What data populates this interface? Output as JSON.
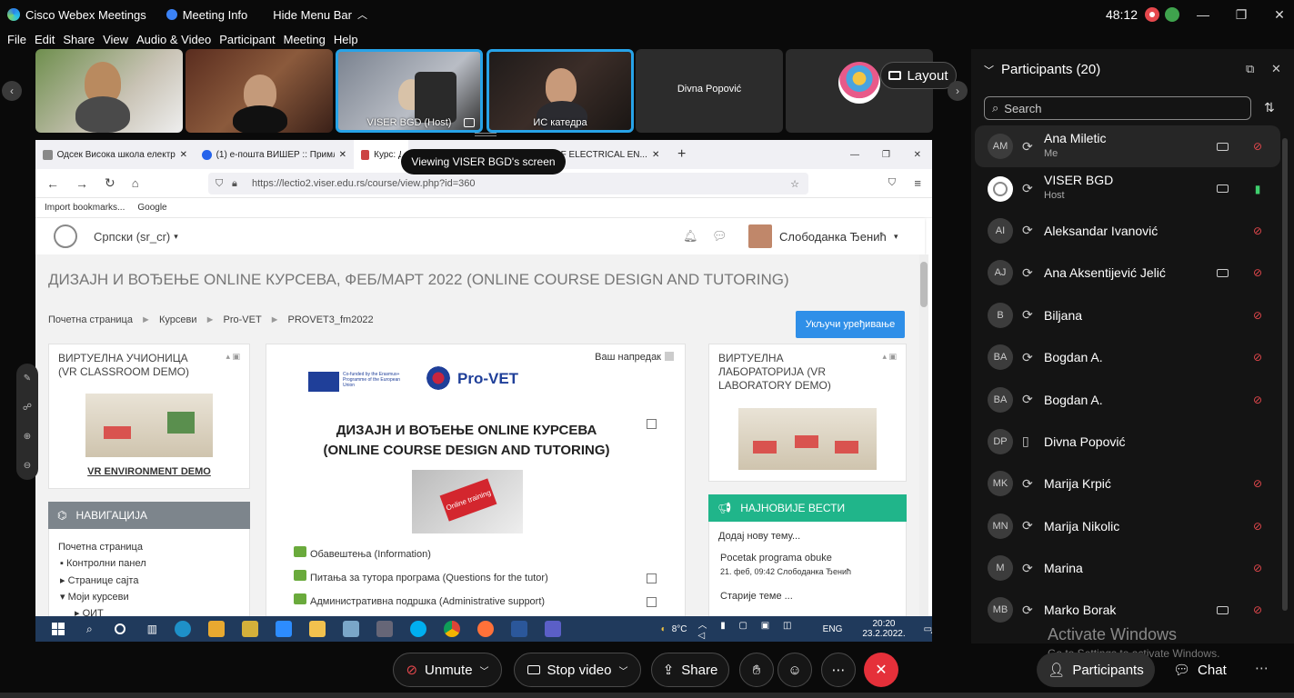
{
  "titlebar": {
    "app": "Cisco Webex Meetings",
    "meeting_info": "Meeting Info",
    "hide_menu": "Hide Menu Bar",
    "timer": "48:12"
  },
  "menu": [
    "File",
    "Edit",
    "Share",
    "View",
    "Audio & Video",
    "Participant",
    "Meeting",
    "Help"
  ],
  "videos": [
    {
      "name": ""
    },
    {
      "name": ""
    },
    {
      "name": "VISER BGD (Host)"
    },
    {
      "name": "ИС катедра"
    },
    {
      "name": "Divna Popović"
    }
  ],
  "layout_label": "Layout",
  "viewing_label": "Viewing VISER BGD's screen",
  "browser": {
    "tabs": [
      "Одсек Висока школа електро...",
      "(1) е-пошта ВИШЕР :: Примље...",
      "Курс: Ди...",
      "...OOL OF ELECTRICAL EN..."
    ],
    "url": "https://lectio2.viser.edu.rs/course/view.php?id=360",
    "bookmarks": [
      "Import bookmarks...",
      "Google"
    ]
  },
  "moodle": {
    "lang": "Српски (sr_cr)",
    "user": "Слободанка Ђенић",
    "course_title": "ДИЗАЈН И ВОЂЕЊЕ ONLINE КУРСЕВА, ФЕБ/МАРТ 2022 (ONLINE COURSE DESIGN AND TUTORING)",
    "breadcrumb": [
      "Почетна страница",
      "Курсеви",
      "Pro-VET",
      "PROVET3_fm2022"
    ],
    "edit_button": "Укључи уређивање",
    "vr_classroom_title": "ВИРТУЕЛНА УЧИОНИЦА (VR CLASSROOM DEMO)",
    "vr_link": "VR ENVIRONMENT DEMO",
    "vr_lab_title": "ВИРТУЕЛНА ЛАБОРАТОРИЈА (VR LABORATORY DEMO)",
    "progress_label": "Ваш напредак",
    "course_heading_1": "ДИЗАЈН И ВОЂЕЊЕ ONLINE КУРСЕВА",
    "course_heading_2": "(ONLINE COURSE DESIGN AND TUTORING)",
    "logo_text": "Pro-VET",
    "eu_text": "Co-funded by the Erasmus+ Programme of the European Union",
    "keyboard_text": "Online training",
    "forums": [
      "Обавештења (Information)",
      "Питања за тутора програма (Questions for the tutor)",
      "Административна подршка (Administrative support)"
    ],
    "nav_title": "НАВИГАЦИЈА",
    "nav_items": [
      "Почетна страница",
      "Контролни панел",
      "Странице сајта",
      "Моји курсеви",
      "ОИТ"
    ],
    "news_title": "НАЈНОВИЈЕ ВЕСТИ",
    "news_add": "Додај нову тему...",
    "news_item_title": "Pocetak programa obuke",
    "news_item_meta": "21. феб, 09:42  Слободанка Ђенић",
    "news_older": "Старије теме ..."
  },
  "taskbar": {
    "temp": "8°C",
    "lang": "ENG",
    "time": "20:20",
    "date": "23.2.2022.",
    "badge": "4"
  },
  "participants": {
    "title": "Participants (20)",
    "search_placeholder": "Search",
    "list": [
      {
        "initials": "AM",
        "name": "Ana Miletic",
        "role": "Me",
        "cam": true,
        "mic": "muted"
      },
      {
        "initials": "",
        "name": "VISER BGD",
        "role": "Host",
        "cam": true,
        "mic": "on"
      },
      {
        "initials": "AI",
        "name": "Aleksandar Ivanović",
        "role": "",
        "cam": false,
        "mic": "muted"
      },
      {
        "initials": "AJ",
        "name": "Ana Aksentijević Jelić",
        "role": "",
        "cam": true,
        "mic": "muted"
      },
      {
        "initials": "B",
        "name": "Biljana",
        "role": "",
        "cam": false,
        "mic": "muted"
      },
      {
        "initials": "BA",
        "name": "Bogdan A.",
        "role": "",
        "cam": false,
        "mic": "muted"
      },
      {
        "initials": "BA",
        "name": "Bogdan A.",
        "role": "",
        "cam": false,
        "mic": "muted"
      },
      {
        "initials": "DP",
        "name": "Divna Popović",
        "role": "",
        "cam": false,
        "mic": "none"
      },
      {
        "initials": "MK",
        "name": "Marija Krpić",
        "role": "",
        "cam": false,
        "mic": "muted"
      },
      {
        "initials": "MN",
        "name": "Marija Nikolic",
        "role": "",
        "cam": false,
        "mic": "muted"
      },
      {
        "initials": "M",
        "name": "Marina",
        "role": "",
        "cam": false,
        "mic": "muted"
      },
      {
        "initials": "MB",
        "name": "Marko Borak",
        "role": "",
        "cam": true,
        "mic": "muted"
      }
    ]
  },
  "activate": {
    "line1": "Activate Windows",
    "line2": "Go to Settings to activate Windows."
  },
  "controls": {
    "unmute": "Unmute",
    "stop_video": "Stop video",
    "share": "Share",
    "participants": "Participants",
    "chat": "Chat"
  },
  "colors": {
    "accent": "#27a3e8",
    "end_call": "#e5303a",
    "muted": "#e5484d",
    "mic_on": "#3fcf6e",
    "news_header": "#20b58a",
    "moodle_button": "#2f8fe8"
  }
}
